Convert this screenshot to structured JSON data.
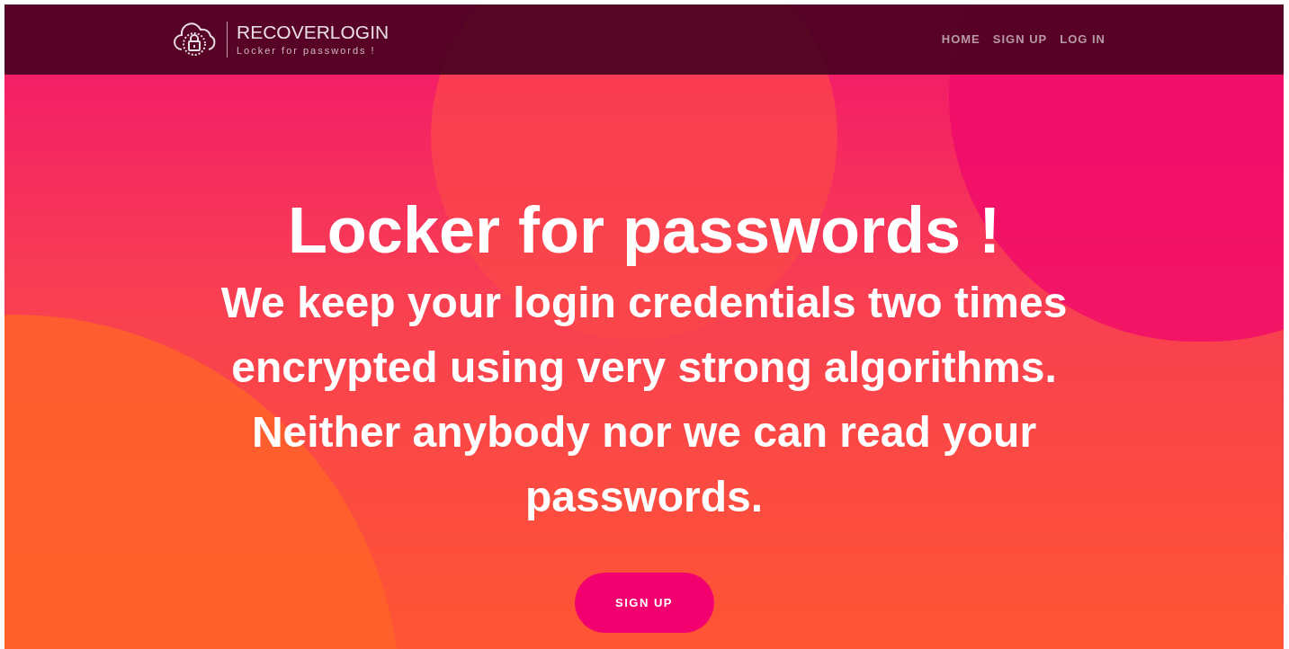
{
  "brand": {
    "name": "RECOVERLOGIN",
    "tagline": "Locker for passwords !"
  },
  "nav": [
    {
      "label": "HOME"
    },
    {
      "label": "SIGN UP"
    },
    {
      "label": "LOG IN"
    }
  ],
  "hero": {
    "title": "Locker for passwords !",
    "text": "We keep your login credentials two times encrypted using very strong algorithms. Neither anybody nor we can read your passwords.",
    "button": "SIGN UP"
  }
}
